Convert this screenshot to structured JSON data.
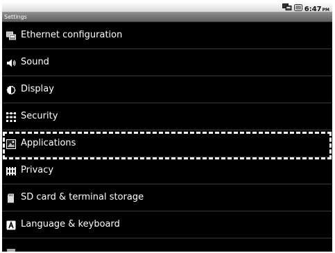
{
  "status_bar": {
    "icons": [
      "ethernet-icon",
      "battery-icon"
    ],
    "time": "6:47",
    "ampm": "PM"
  },
  "title_bar": {
    "title": "Settings"
  },
  "settings": {
    "items": [
      {
        "label": "Ethernet configuration",
        "icon": "ethernet-icon"
      },
      {
        "label": "Sound",
        "icon": "speaker-icon"
      },
      {
        "label": "Display",
        "icon": "brightness-icon"
      },
      {
        "label": "Security",
        "icon": "security-grid-icon"
      },
      {
        "label": "Applications",
        "icon": "applications-icon",
        "focused": true
      },
      {
        "label": "Privacy",
        "icon": "privacy-icon"
      },
      {
        "label": "SD card & terminal storage",
        "icon": "sd-card-icon"
      },
      {
        "label": "Language & keyboard",
        "icon": "keyboard-a-icon"
      },
      {
        "label": "",
        "icon": "voice-icon"
      }
    ]
  },
  "colors": {
    "list_background": "#000000",
    "text": "#ffffff",
    "divider": "#3a3a3a",
    "focus_outline": "#ffffff"
  }
}
